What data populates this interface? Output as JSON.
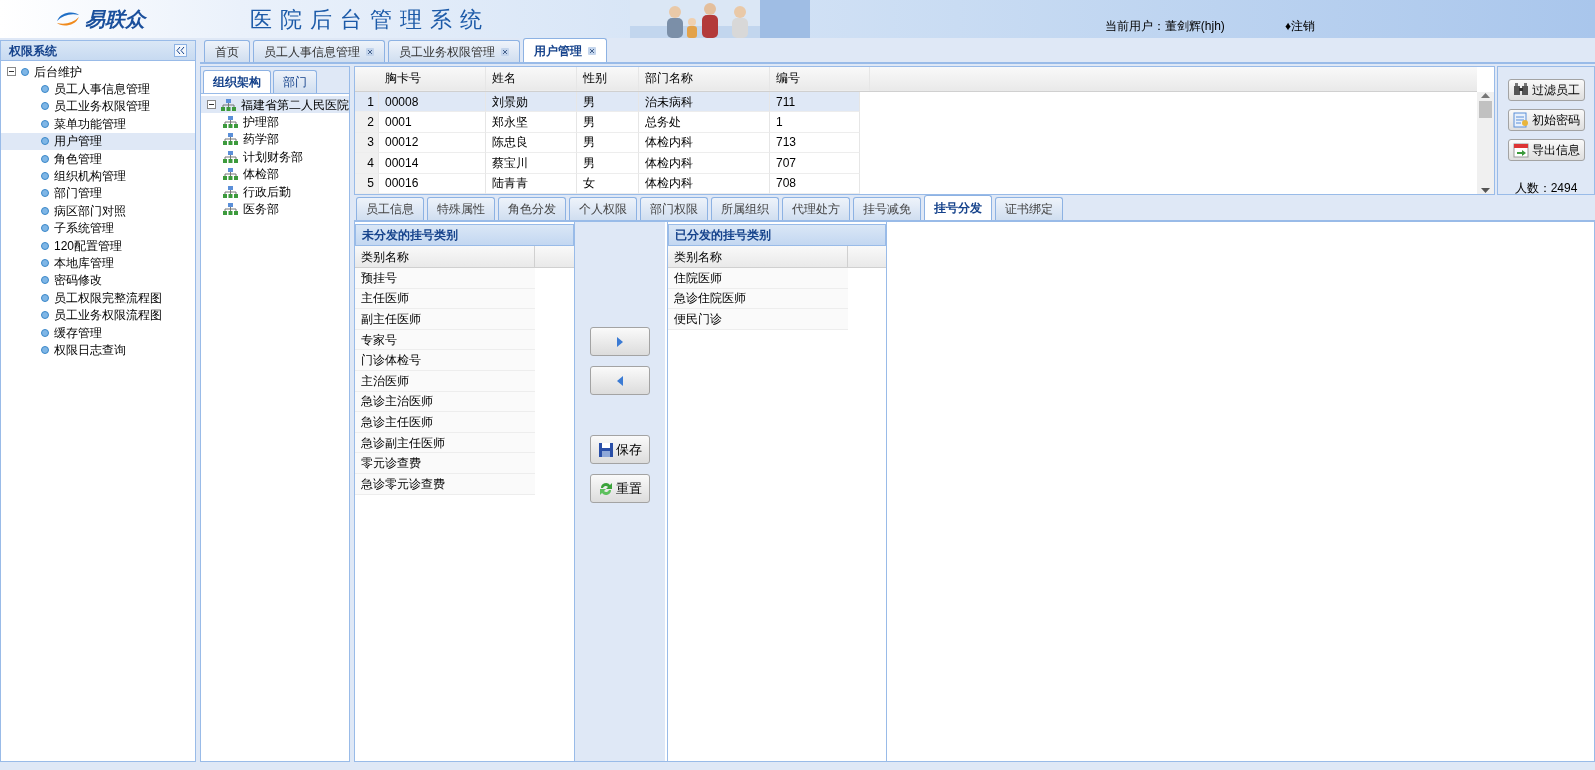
{
  "header": {
    "logo": "易联众",
    "title": "医院后台管理系统",
    "user_label": "当前用户：董剑辉(hjh)",
    "logout": "♦注销"
  },
  "sidebar": {
    "title": "权限系统",
    "tree": [
      {
        "label": "后台维护",
        "expanded": true,
        "selected": false,
        "children": [
          {
            "label": "员工人事信息管理",
            "selected": false
          },
          {
            "label": "员工业务权限管理",
            "selected": false
          },
          {
            "label": "菜单功能管理",
            "selected": false
          },
          {
            "label": "用户管理",
            "selected": true
          },
          {
            "label": "角色管理",
            "selected": false
          },
          {
            "label": "组织机构管理",
            "selected": false
          },
          {
            "label": "部门管理",
            "selected": false
          },
          {
            "label": "病区部门对照",
            "selected": false
          },
          {
            "label": "子系统管理",
            "selected": false
          },
          {
            "label": "120配置管理",
            "selected": false
          },
          {
            "label": "本地库管理",
            "selected": false
          },
          {
            "label": "密码修改",
            "selected": false
          },
          {
            "label": "员工权限完整流程图",
            "selected": false
          },
          {
            "label": "员工业务权限流程图",
            "selected": false
          },
          {
            "label": "缓存管理",
            "selected": false
          },
          {
            "label": "权限日志查询",
            "selected": false
          }
        ]
      }
    ]
  },
  "tabs": [
    {
      "label": "首页",
      "closable": false,
      "selected": false
    },
    {
      "label": "员工人事信息管理",
      "closable": true,
      "selected": false
    },
    {
      "label": "员工业务权限管理",
      "closable": true,
      "selected": false
    },
    {
      "label": "用户管理",
      "closable": true,
      "selected": true
    }
  ],
  "org_panel": {
    "tabs": [
      {
        "label": "组织架构",
        "selected": true
      },
      {
        "label": "部门",
        "selected": false
      }
    ],
    "tree": [
      {
        "label": "福建省第二人民医院",
        "expanded": true,
        "selected": true,
        "children": [
          {
            "label": "护理部",
            "selected": false
          },
          {
            "label": "药学部",
            "selected": false
          },
          {
            "label": "计划财务部",
            "selected": false
          },
          {
            "label": "体检部",
            "selected": false
          },
          {
            "label": "行政后勤",
            "selected": false
          },
          {
            "label": "医务部",
            "selected": false
          }
        ]
      }
    ]
  },
  "grid": {
    "columns": [
      "胸卡号",
      "姓名",
      "性别",
      "部门名称",
      "编号"
    ],
    "rows": [
      {
        "number": "1",
        "cells": [
          "00008",
          "刘景勋",
          "男",
          "治未病科",
          "711"
        ],
        "selected": true
      },
      {
        "number": "2",
        "cells": [
          "0001",
          "郑永坚",
          "男",
          "总务处",
          "1"
        ],
        "selected": false
      },
      {
        "number": "3",
        "cells": [
          "00012",
          "陈忠良",
          "男",
          "体检内科",
          "713"
        ],
        "selected": false
      },
      {
        "number": "4",
        "cells": [
          "00014",
          "蔡宝川",
          "男",
          "体检内科",
          "707"
        ],
        "selected": false
      },
      {
        "number": "5",
        "cells": [
          "00016",
          "陆青青",
          "女",
          "体检内科",
          "708"
        ],
        "selected": false
      }
    ]
  },
  "actions": {
    "buttons": [
      {
        "label": "过滤员工",
        "kind": "filter"
      },
      {
        "label": "初始密码",
        "kind": "password"
      },
      {
        "label": "导出信息",
        "kind": "export"
      }
    ],
    "count": "人数：2494"
  },
  "detail_tabs": [
    {
      "label": "员工信息",
      "selected": false
    },
    {
      "label": "特殊属性",
      "selected": false
    },
    {
      "label": "角色分发",
      "selected": false
    },
    {
      "label": "个人权限",
      "selected": false
    },
    {
      "label": "部门权限",
      "selected": false
    },
    {
      "label": "所属组织",
      "selected": false
    },
    {
      "label": "代理处方",
      "selected": false
    },
    {
      "label": "挂号减免",
      "selected": false
    },
    {
      "label": "挂号分发",
      "selected": true
    },
    {
      "label": "证书绑定",
      "selected": false
    }
  ],
  "unassigned": {
    "title": "未分发的挂号类别",
    "column": "类别名称",
    "items": [
      "预挂号",
      "主任医师",
      "副主任医师",
      "专家号",
      "门诊体检号",
      "主治医师",
      "急诊主治医师",
      "急诊主任医师",
      "急诊副主任医师",
      "零元诊查费",
      "急诊零元诊查费"
    ]
  },
  "transfer_buttons": [
    {
      "kind": "move_right"
    },
    {
      "kind": "move_left"
    },
    {
      "kind": "save",
      "label": "保存"
    },
    {
      "kind": "reset",
      "label": "重置"
    }
  ],
  "assigned": {
    "title": "已分发的挂号类别",
    "column": "类别名称",
    "items": [
      "住院医师",
      "急诊住院医师",
      "便民门诊"
    ]
  }
}
